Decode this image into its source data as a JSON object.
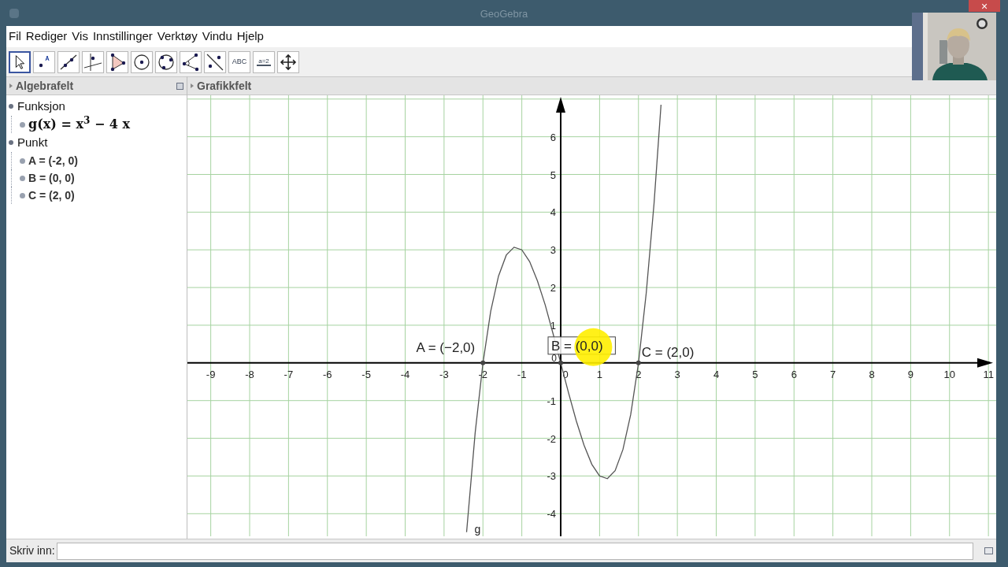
{
  "window": {
    "title": "GeoGebra",
    "close": "×"
  },
  "menu": [
    "Fil",
    "Rediger",
    "Vis",
    "Innstillinger",
    "Verktøy",
    "Vindu",
    "Hjelp"
  ],
  "toolbar": [
    {
      "kind": "move",
      "selected": true
    },
    {
      "kind": "point",
      "selected": false
    },
    {
      "kind": "line",
      "selected": false
    },
    {
      "kind": "perpendicular",
      "selected": false
    },
    {
      "kind": "polygon",
      "selected": false
    },
    {
      "kind": "circle",
      "selected": false
    },
    {
      "kind": "conic",
      "selected": false
    },
    {
      "kind": "angle",
      "selected": false
    },
    {
      "kind": "reflect",
      "selected": false
    },
    {
      "kind": "text",
      "selected": false,
      "text": "ABC"
    },
    {
      "kind": "slider",
      "selected": false,
      "text": "a=2"
    },
    {
      "kind": "move-view",
      "selected": false
    }
  ],
  "algebra": {
    "title": "Algebrafelt",
    "groups": [
      {
        "label": "Funksjon",
        "children": [
          {
            "text": "g(x) = x$^{3}$ − 4 x",
            "kind": "formula"
          }
        ]
      },
      {
        "label": "Punkt",
        "children": [
          {
            "text": "A = (-2, 0)",
            "kind": "point"
          },
          {
            "text": "B = (0, 0)",
            "kind": "point"
          },
          {
            "text": "C = (2, 0)",
            "kind": "point"
          }
        ]
      }
    ]
  },
  "graphics": {
    "title": "Grafikkfelt",
    "cursor_highlight": true,
    "point_labels": [
      {
        "selected": false
      },
      {
        "selected": true
      },
      {
        "selected": false
      }
    ],
    "chart_data": {
      "type": "line",
      "xlim": [
        -9.6,
        11.2
      ],
      "ylim": [
        -4.6,
        7.1
      ],
      "xticks": [
        -9,
        -8,
        -7,
        -6,
        -5,
        -4,
        -3,
        -2,
        -1,
        0,
        1,
        2,
        3,
        4,
        5,
        6,
        7,
        8,
        9,
        10,
        11
      ],
      "yticks": [
        -4,
        -3,
        -2,
        -1,
        1,
        2,
        3,
        4,
        5,
        6
      ],
      "x": [
        -2.42,
        -2.2,
        -2,
        -1.8,
        -1.6,
        -1.4,
        -1.2,
        -1,
        -0.8,
        -0.6,
        -0.4,
        -0.2,
        0,
        0.2,
        0.4,
        0.6,
        0.8,
        1,
        1.2,
        1.4,
        1.6,
        1.8,
        2,
        2.2,
        2.4,
        2.58
      ],
      "series": [
        {
          "name": "g",
          "color": "#555555",
          "values": [
            -4.49,
            -1.85,
            0,
            1.37,
            2.3,
            2.86,
            3.07,
            3,
            2.69,
            2.18,
            1.54,
            0.79,
            0,
            -0.79,
            -1.54,
            -2.18,
            -2.69,
            -3,
            -3.07,
            -2.86,
            -2.3,
            -1.37,
            0,
            1.85,
            4.22,
            6.85
          ]
        }
      ],
      "annotations": [
        {
          "x": -2,
          "y": 0,
          "text": "A = (−2,0)"
        },
        {
          "x": 0,
          "y": 0,
          "text": "B = (0,0)"
        },
        {
          "x": 2,
          "y": 0,
          "text": "C = (2,0)"
        }
      ],
      "grid": true
    },
    "origin_label": "0"
  },
  "input_bar": {
    "label": "Skriv inn:"
  }
}
